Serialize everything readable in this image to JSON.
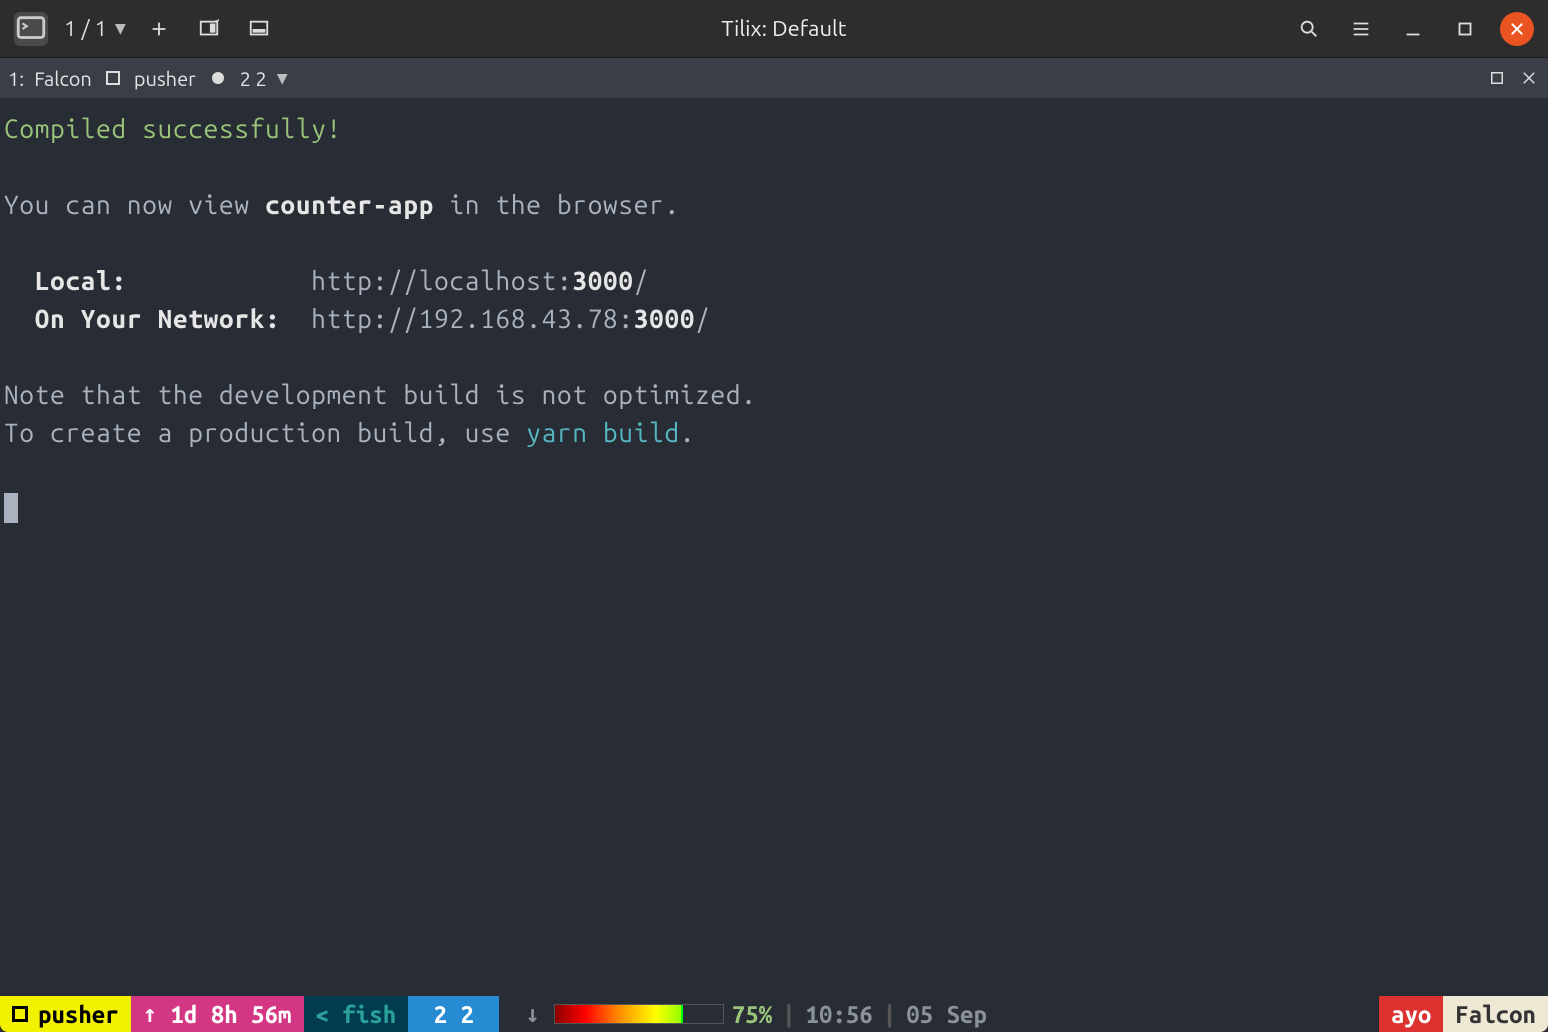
{
  "titlebar": {
    "tab_counter": "1 / 1",
    "title": "Tilix: Default"
  },
  "sessionbar": {
    "index": "1:",
    "host": "Falcon",
    "dir": "pusher",
    "panes": "2 2"
  },
  "terminal": {
    "compiled": "Compiled successfully!",
    "view_pre": "You can now view ",
    "app_name": "counter-app",
    "view_post": " in the browser.",
    "local_label": "  Local:           ",
    "local_url_pre": " http://localhost:",
    "local_port": "3000",
    "local_url_post": "/",
    "net_label": "  On Your Network: ",
    "net_url_pre": " http://192.168.43.78:",
    "net_port": "3000",
    "net_url_post": "/",
    "note1": "Note that the development build is not optimized.",
    "note2_pre": "To create a production build, use ",
    "note2_cmd": "yarn build",
    "note2_post": "."
  },
  "statusbar": {
    "session": "pusher",
    "uptime_arrow": "↑",
    "uptime": " 1d 8h 56m",
    "shell_pre": "< ",
    "shell": "fish",
    "panes": " 2 2 ",
    "net_arrow": "↓",
    "battery_pct": "75%",
    "time": "10:56",
    "date": "05 Sep",
    "user": "ayo",
    "host": "Falcon"
  }
}
